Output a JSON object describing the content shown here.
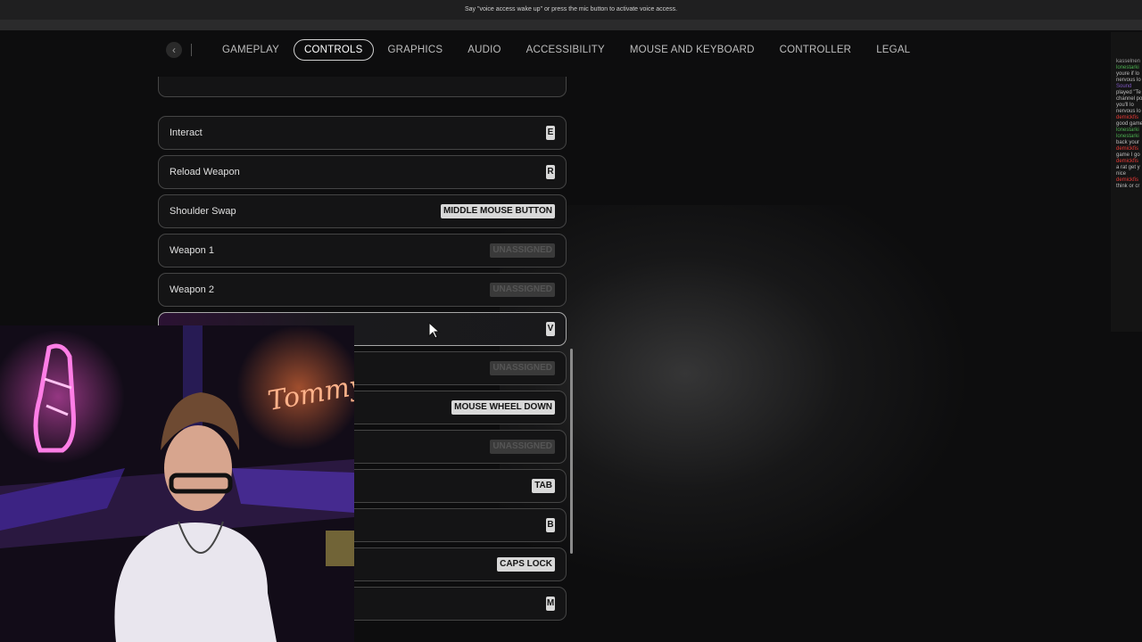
{
  "system_banner": {
    "text": "Say \"voice access wake up\" or press the mic button to activate voice access."
  },
  "nav": {
    "tabs": [
      {
        "label": "GAMEPLAY"
      },
      {
        "label": "CONTROLS"
      },
      {
        "label": "GRAPHICS"
      },
      {
        "label": "AUDIO"
      },
      {
        "label": "ACCESSIBILITY"
      },
      {
        "label": "MOUSE AND KEYBOARD"
      },
      {
        "label": "CONTROLLER"
      },
      {
        "label": "LEGAL"
      }
    ],
    "active_tab": "CONTROLS"
  },
  "bindings": [
    {
      "label": "Interact",
      "key": "E"
    },
    {
      "label": "Reload Weapon",
      "key": "R"
    },
    {
      "label": "Shoulder Swap",
      "key": "MIDDLE MOUSE BUTTON"
    },
    {
      "label": "Weapon 1",
      "key": "UNASSIGNED"
    },
    {
      "label": "Weapon 2",
      "key": "UNASSIGNED"
    },
    {
      "label": "",
      "key": "V"
    },
    {
      "label": "",
      "key": "UNASSIGNED"
    },
    {
      "label": "",
      "key": "MOUSE WHEEL DOWN"
    },
    {
      "label": "",
      "key": "UNASSIGNED"
    },
    {
      "label": "",
      "key": "TAB"
    },
    {
      "label": "",
      "key": "B"
    },
    {
      "label": "",
      "key": "CAPS LOCK"
    },
    {
      "label": "",
      "key": "M"
    }
  ],
  "webcam": {
    "neon_sign_text": "Tommy"
  },
  "chat": {
    "lines": [
      {
        "text": "kasselnen",
        "color": "#9a9a9a"
      },
      {
        "text": "lonestarki",
        "color": "#4caf50"
      },
      {
        "text": "youre if lo",
        "color": "#bbbbbb"
      },
      {
        "text": "nervous lo",
        "color": "#bbbbbb"
      },
      {
        "text": "Sound",
        "color": "#7e57c2"
      },
      {
        "text": "played \"Te",
        "color": "#bbbbbb"
      },
      {
        "text": "channel po",
        "color": "#bbbbbb"
      },
      {
        "text": "you'll lo",
        "color": "#bbbbbb"
      },
      {
        "text": "nervous lo",
        "color": "#bbbbbb"
      },
      {
        "text": "demickfis",
        "color": "#e53935"
      },
      {
        "text": "good game",
        "color": "#bbbbbb"
      },
      {
        "text": "lonestarki",
        "color": "#4caf50"
      },
      {
        "text": "lonestarki",
        "color": "#4caf50"
      },
      {
        "text": "back your",
        "color": "#bbbbbb"
      },
      {
        "text": "demickfis",
        "color": "#e53935"
      },
      {
        "text": "game I go",
        "color": "#bbbbbb"
      },
      {
        "text": "demickfis",
        "color": "#e53935"
      },
      {
        "text": "a rat get y",
        "color": "#bbbbbb"
      },
      {
        "text": "nice",
        "color": "#bbbbbb"
      },
      {
        "text": "demickfis",
        "color": "#e53935"
      },
      {
        "text": "think or cr",
        "color": "#bbbbbb"
      }
    ]
  }
}
